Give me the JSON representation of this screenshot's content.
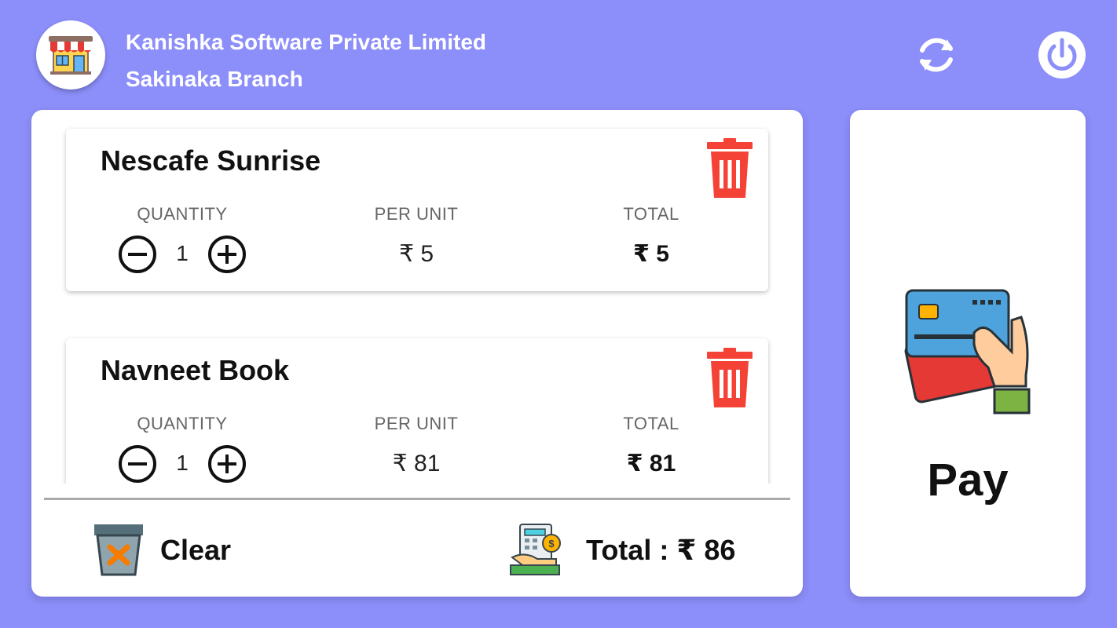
{
  "header": {
    "company_name": "Kanishka Software Private Limited",
    "branch_name": "Sakinaka Branch",
    "logo_icon": "storefront-icon",
    "refresh_icon": "refresh-icon",
    "power_icon": "power-icon"
  },
  "columns": {
    "quantity": "QUANTITY",
    "per_unit": "PER UNIT",
    "total": "TOTAL"
  },
  "cart": {
    "items": [
      {
        "name": "Nescafe Sunrise",
        "quantity": "1",
        "per_unit": "₹ 5",
        "total": "₹ 5"
      },
      {
        "name": "Navneet Book",
        "quantity": "1",
        "per_unit": "₹ 81",
        "total": "₹ 81"
      }
    ]
  },
  "footer": {
    "clear_label": "Clear",
    "total_label": "Total : ₹ 86"
  },
  "pay": {
    "label": "Pay",
    "icon": "credit-card-hand-icon"
  },
  "colors": {
    "background": "#8c8ef9",
    "trash_red": "#f44336",
    "panel": "#ffffff"
  }
}
